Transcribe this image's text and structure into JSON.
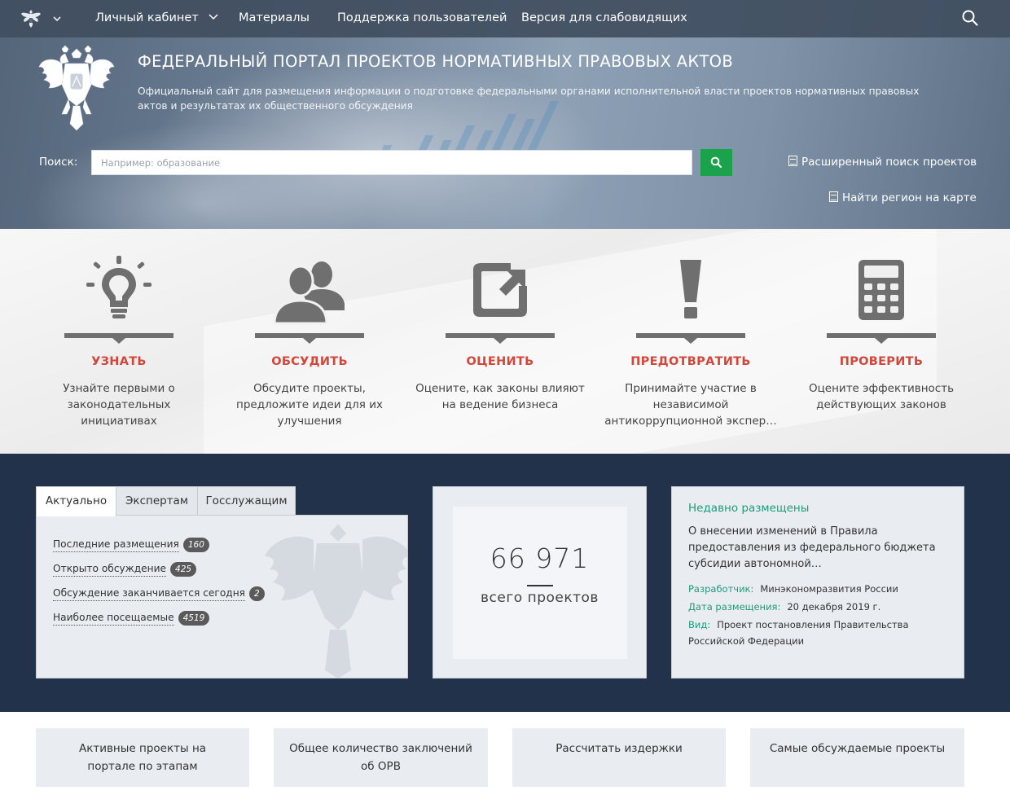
{
  "nav": {
    "items": [
      "Личный кабинет",
      "Материалы",
      "Поддержка пользователей",
      "Версия для слабовидящих"
    ]
  },
  "hero": {
    "title": "ФЕДЕРАЛЬНЫЙ ПОРТАЛ ПРОЕКТОВ НОРМАТИВНЫХ ПРАВОВЫХ АКТОВ",
    "subtitle": "Официальный сайт для размещения информации о подготовке федеральными органами исполнительной власти проектов нормативных правовых актов и результатах их общественного обсуждения",
    "search_label": "Поиск:",
    "search_placeholder": "Например: образование",
    "advanced_search": "Расширенный поиск проектов",
    "region_map": "Найти регион на карте"
  },
  "features": [
    {
      "title": "УЗНАТЬ",
      "text": "Узнайте первыми о законодательных инициативах",
      "icon": "lightbulb-icon"
    },
    {
      "title": "ОБСУДИТЬ",
      "text": "Обсудите проекты, предложите идеи для их улучшения",
      "icon": "people-icon"
    },
    {
      "title": "ОЦЕНИТЬ",
      "text": "Оцените, как законы влияют на ведение бизнеса",
      "icon": "share-arrow-icon"
    },
    {
      "title": "ПРЕДОТВРАТИТЬ",
      "text": "Принимайте участие в независимой антикоррупционной экспер…",
      "icon": "exclamation-icon"
    },
    {
      "title": "ПРОВЕРИТЬ",
      "text": "Оцените эффективность действующих законов",
      "icon": "calculator-icon"
    }
  ],
  "tabs": {
    "labels": [
      "Актуально",
      "Экспертам",
      "Госслужащим"
    ],
    "active": 0,
    "stats": [
      {
        "label": "Последние размещения",
        "count": "160"
      },
      {
        "label": "Открыто обсуждение",
        "count": "425"
      },
      {
        "label": "Обсуждение заканчивается сегодня",
        "count": "2"
      },
      {
        "label": "Наиболее посещаемые",
        "count": "4519"
      }
    ]
  },
  "total": {
    "number": "66 971",
    "label": "всего проектов"
  },
  "recent": {
    "heading": "Недавно размещены",
    "title": "О внесении изменений в Правила предоставления из федерального бюджета субсидии автономной…",
    "developer_key": "Разработчик:",
    "developer": "Минэкономразвития России",
    "date_key": "Дата размещения:",
    "date": "20 декабря 2019 г.",
    "type_key": "Вид:",
    "type": "Проект постановления Правительства Российской Федерации"
  },
  "bottom": [
    "Активные проекты на портале по этапам",
    "Общее количество заключений об ОРВ",
    "Рассчитать издержки",
    "Самые обсуждаемые проекты"
  ],
  "colors": {
    "accent_red": "#d2473b",
    "accent_green": "#1aa34a",
    "teal_text": "#1e9a7a",
    "dark_navy": "#22324b",
    "nav_bg": "#404e60"
  }
}
